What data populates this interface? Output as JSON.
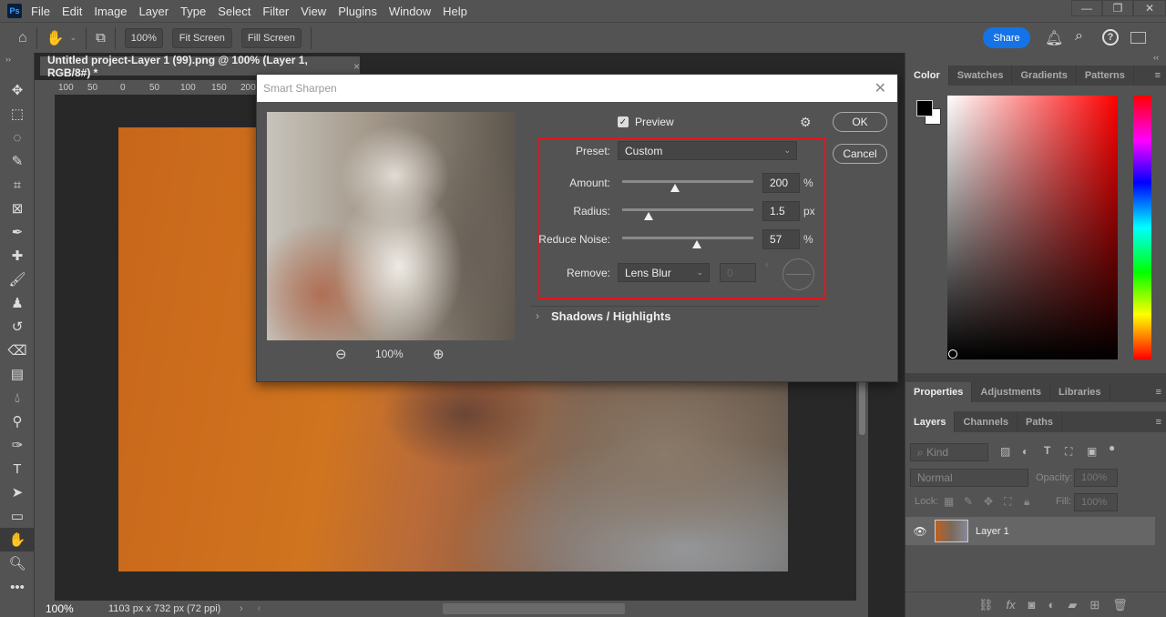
{
  "menu": {
    "logo": "Ps",
    "items": [
      "File",
      "Edit",
      "Image",
      "Layer",
      "Type",
      "Select",
      "Filter",
      "View",
      "Plugins",
      "Window",
      "Help"
    ]
  },
  "options": {
    "zoom": "100%",
    "fit": "Fit Screen",
    "fill": "Fill Screen",
    "share": "Share"
  },
  "document": {
    "tab": "Untitled project-Layer 1 (99).png @ 100% (Layer 1, RGB/8#) *",
    "ruler": [
      "100",
      "50",
      "0",
      "50",
      "100",
      "150",
      "200"
    ],
    "status_zoom": "100%",
    "status_info": "1103 px x 732 px (72 ppi)"
  },
  "dialog": {
    "title": "Smart Sharpen",
    "preview_label": "Preview",
    "preview_checked": true,
    "ok": "OK",
    "cancel": "Cancel",
    "zoom": "100%",
    "preset_label": "Preset:",
    "preset": "Custom",
    "amount_label": "Amount:",
    "amount": "200",
    "amount_unit": "%",
    "amount_frac": 0.4,
    "radius_label": "Radius:",
    "radius": "1.5",
    "radius_unit": "px",
    "radius_frac": 0.2,
    "noise_label": "Reduce Noise:",
    "noise": "57",
    "noise_unit": "%",
    "noise_frac": 0.57,
    "remove_label": "Remove:",
    "remove": "Lens Blur",
    "angle": "0",
    "angle_unit": "°",
    "shadows": "Shadows / Highlights",
    "highlight_color": "#e3161e"
  },
  "color_panel": {
    "tabs": [
      "Color",
      "Swatches",
      "Gradients",
      "Patterns"
    ],
    "hue_color": "#ff0000"
  },
  "properties_panel": {
    "tabs": [
      "Properties",
      "Adjustments",
      "Libraries"
    ]
  },
  "layers_panel": {
    "tabs": [
      "Layers",
      "Channels",
      "Paths"
    ],
    "filter": "Kind",
    "blend": "Normal",
    "opacity_label": "Opacity:",
    "opacity": "100%",
    "lock_label": "Lock:",
    "fill_label": "Fill:",
    "fill": "100%",
    "layers": [
      {
        "name": "Layer 1",
        "visible": true
      }
    ]
  }
}
